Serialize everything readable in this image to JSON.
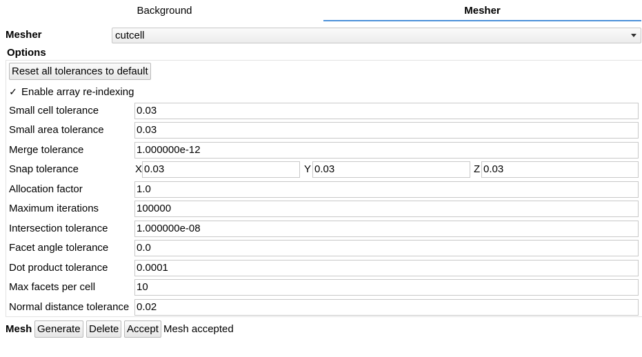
{
  "tabs": [
    {
      "label": "Background",
      "active": false
    },
    {
      "label": "Mesher",
      "active": true
    }
  ],
  "mesher": {
    "label": "Mesher",
    "value": "cutcell"
  },
  "options": {
    "title": "Options",
    "reset_button": "Reset all tolerances to default",
    "reindex": {
      "label": "Enable array re-indexing",
      "checked": true,
      "glyph": "✓"
    },
    "fields": [
      {
        "label": "Small cell tolerance",
        "value": "0.03"
      },
      {
        "label": "Small area tolerance",
        "value": "0.03"
      },
      {
        "label": "Merge tolerance",
        "value": "1.000000e-12"
      },
      {
        "label": "Snap tolerance",
        "x_label": "X",
        "x": "0.03",
        "y_label": "Y",
        "y": "0.03",
        "z_label": "Z",
        "z": "0.03"
      },
      {
        "label": "Allocation factor",
        "value": "1.0"
      },
      {
        "label": "Maximum iterations",
        "value": "100000"
      },
      {
        "label": "Intersection tolerance",
        "value": "1.000000e-08"
      },
      {
        "label": "Facet angle tolerance",
        "value": "0.0"
      },
      {
        "label": "Dot product tolerance",
        "value": "0.0001"
      },
      {
        "label": "Max facets per cell",
        "value": "10"
      },
      {
        "label": "Normal distance tolerance",
        "value": "0.02"
      }
    ]
  },
  "mesh": {
    "label": "Mesh",
    "generate": "Generate",
    "delete": "Delete",
    "accept": "Accept",
    "status": "Mesh accepted"
  },
  "colors": {
    "tab_underline": "#4a90d9"
  },
  "icons": {
    "dropdown": "chevron-down-icon",
    "check": "checkmark-icon"
  }
}
